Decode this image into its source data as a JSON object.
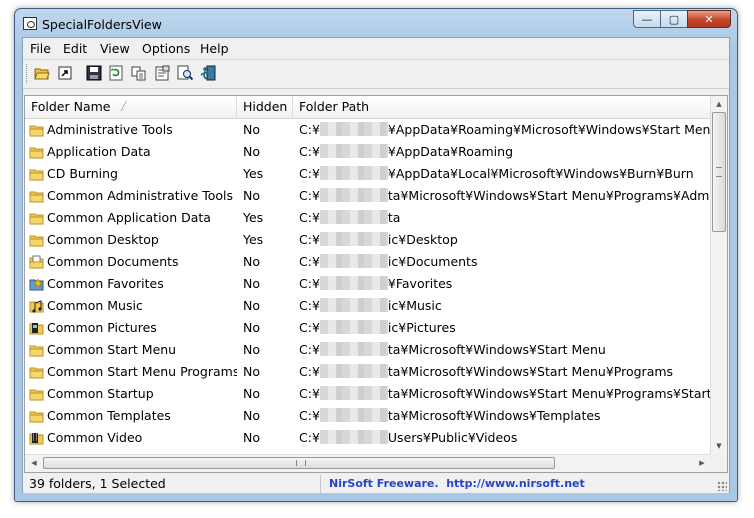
{
  "window": {
    "title": "SpecialFoldersView"
  },
  "menu": [
    "File",
    "Edit",
    "View",
    "Options",
    "Help"
  ],
  "toolbar": [
    {
      "name": "open-folder-icon"
    },
    {
      "name": "open-shortcut-icon"
    },
    {
      "name": "save-icon"
    },
    {
      "name": "refresh-icon"
    },
    {
      "name": "copy-icon"
    },
    {
      "name": "properties-icon"
    },
    {
      "name": "find-icon"
    },
    {
      "name": "exit-icon"
    }
  ],
  "columns": [
    "Folder Name",
    "Hidden",
    "Folder Path"
  ],
  "rows": [
    {
      "name": "Administrative Tools",
      "hidden": "No",
      "path_start": "C:¥",
      "path_end": "¥AppData¥Roaming¥Microsoft¥Windows¥Start Menu¥Pro",
      "icon": "folder-icon"
    },
    {
      "name": "Application Data",
      "hidden": "No",
      "path_start": "C:¥",
      "path_end": "¥AppData¥Roaming",
      "icon": "folder-icon"
    },
    {
      "name": "CD Burning",
      "hidden": "Yes",
      "path_start": "C:¥",
      "path_end": "¥AppData¥Local¥Microsoft¥Windows¥Burn¥Burn",
      "icon": "folder-icon"
    },
    {
      "name": "Common Administrative Tools",
      "hidden": "No",
      "path_start": "C:¥",
      "path_end": "ta¥Microsoft¥Windows¥Start Menu¥Programs¥Administr",
      "icon": "folder-icon"
    },
    {
      "name": "Common Application Data",
      "hidden": "Yes",
      "path_start": "C:¥",
      "path_end": "ta",
      "icon": "folder-icon"
    },
    {
      "name": "Common Desktop",
      "hidden": "Yes",
      "path_start": "C:¥",
      "path_end": "ic¥Desktop",
      "icon": "folder-icon"
    },
    {
      "name": "Common Documents",
      "hidden": "No",
      "path_start": "C:¥",
      "path_end": "ic¥Documents",
      "icon": "documents-folder-icon"
    },
    {
      "name": "Common Favorites",
      "hidden": "No",
      "path_start": "C:¥",
      "path_end": "¥Favorites",
      "icon": "favorites-folder-icon"
    },
    {
      "name": "Common Music",
      "hidden": "No",
      "path_start": "C:¥",
      "path_end": "ic¥Music",
      "icon": "music-folder-icon"
    },
    {
      "name": "Common Pictures",
      "hidden": "No",
      "path_start": "C:¥",
      "path_end": "ic¥Pictures",
      "icon": "pictures-folder-icon"
    },
    {
      "name": "Common Start Menu",
      "hidden": "No",
      "path_start": "C:¥",
      "path_end": "ta¥Microsoft¥Windows¥Start Menu",
      "icon": "folder-icon"
    },
    {
      "name": "Common Start Menu Programs",
      "hidden": "No",
      "path_start": "C:¥",
      "path_end": "ta¥Microsoft¥Windows¥Start Menu¥Programs",
      "icon": "folder-icon"
    },
    {
      "name": "Common Startup",
      "hidden": "No",
      "path_start": "C:¥",
      "path_end": "ta¥Microsoft¥Windows¥Start Menu¥Programs¥Startup",
      "icon": "folder-icon"
    },
    {
      "name": "Common Templates",
      "hidden": "No",
      "path_start": "C:¥",
      "path_end": "ta¥Microsoft¥Windows¥Templates",
      "icon": "folder-icon"
    },
    {
      "name": "Common Video",
      "hidden": "No",
      "path_start": "C:¥",
      "path_end": "Users¥Public¥Videos",
      "icon": "video-folder-icon"
    }
  ],
  "status": {
    "count": "39 folders, 1 Selected",
    "credit": "NirSoft Freeware.  http://www.nirsoft.net"
  }
}
